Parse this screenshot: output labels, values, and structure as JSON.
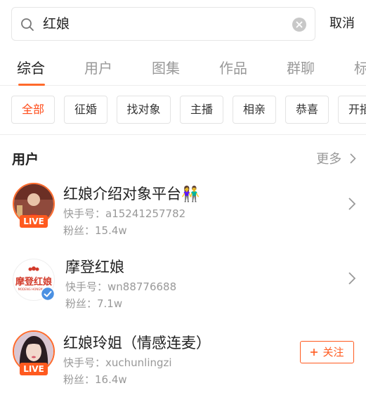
{
  "search": {
    "query": "红娘",
    "cancel_label": "取消"
  },
  "tabs": [
    {
      "label": "综合",
      "active": true
    },
    {
      "label": "用户",
      "active": false
    },
    {
      "label": "图集",
      "active": false
    },
    {
      "label": "作品",
      "active": false
    },
    {
      "label": "群聊",
      "active": false
    },
    {
      "label": "标",
      "active": false
    }
  ],
  "chips": [
    {
      "label": "全部",
      "active": true
    },
    {
      "label": "征婚"
    },
    {
      "label": "找对象"
    },
    {
      "label": "主播"
    },
    {
      "label": "相亲"
    },
    {
      "label": "恭喜"
    },
    {
      "label": "开播"
    }
  ],
  "users_section": {
    "title": "用户",
    "more_label": "更多",
    "users": [
      {
        "name": "红娘介绍对象平台👫",
        "id_line": "快手号：a15241257782",
        "fans_line": "粉丝：15.4w",
        "live_label": "LIVE",
        "action": "chevron"
      },
      {
        "name": "摩登红娘",
        "id_line": "快手号：wn88776688",
        "fans_line": "粉丝：7.1w",
        "logo_text": "摩登红娘",
        "logo_subtext": "MODENG HONGNIANG",
        "verified": true,
        "action": "chevron"
      },
      {
        "name": "红娘玲姐（情感连麦）",
        "id_line": "快手号：xuchunlingzi",
        "fans_line": "粉丝：16.4w",
        "live_label": "LIVE",
        "action": "follow",
        "follow_label": "关注"
      }
    ]
  },
  "colors": {
    "accent": "#ff5a1f",
    "muted": "#999999",
    "border": "#e3e3e3"
  }
}
